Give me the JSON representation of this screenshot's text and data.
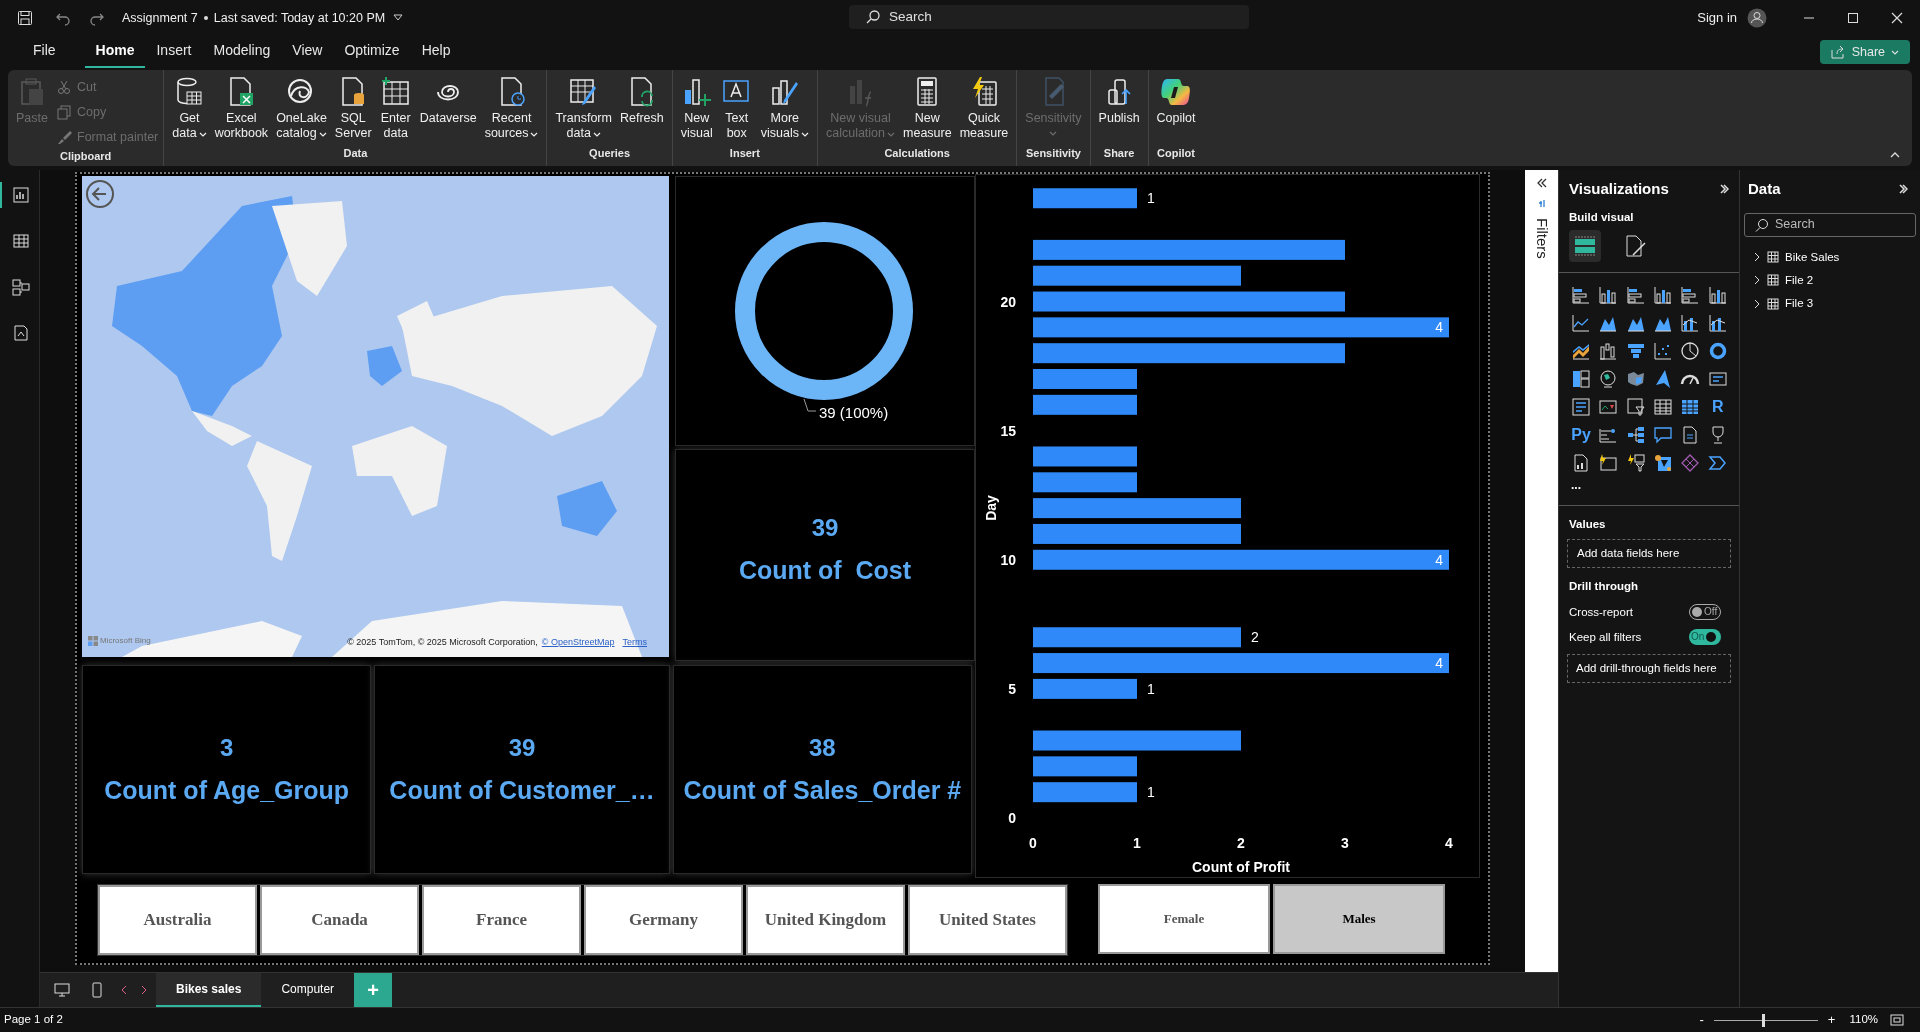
{
  "title_bar": {
    "document": "Assignment 7",
    "saved": "Last saved: Today at 10:20 PM",
    "search_placeholder": "Search",
    "sign_in": "Sign in"
  },
  "menu_tabs": [
    {
      "label": "File",
      "selected": false
    },
    {
      "label": "Home",
      "selected": true
    },
    {
      "label": "Insert",
      "selected": false
    },
    {
      "label": "Modeling",
      "selected": false
    },
    {
      "label": "View",
      "selected": false
    },
    {
      "label": "Optimize",
      "selected": false
    },
    {
      "label": "Help",
      "selected": false
    }
  ],
  "share_button": "Share",
  "ribbon": [
    {
      "label": "Clipboard",
      "items": [
        {
          "kind": "large",
          "lines": [
            "Paste"
          ],
          "caret": false,
          "disabled": true
        },
        {
          "kind": "small",
          "lines": [
            "Cut"
          ],
          "caret": false,
          "disabled": true
        },
        {
          "kind": "small",
          "lines": [
            "Copy"
          ],
          "caret": false,
          "disabled": true
        },
        {
          "kind": "small",
          "lines": [
            "Format painter"
          ],
          "caret": false,
          "disabled": true
        }
      ]
    },
    {
      "label": "Data",
      "items": [
        {
          "kind": "large",
          "lines": [
            "Get",
            "data"
          ],
          "caret": true,
          "disabled": false
        },
        {
          "kind": "large",
          "lines": [
            "Excel",
            "workbook"
          ],
          "caret": false,
          "disabled": false
        },
        {
          "kind": "large",
          "lines": [
            "OneLake",
            "catalog"
          ],
          "caret": true,
          "disabled": false
        },
        {
          "kind": "large",
          "lines": [
            "SQL",
            "Server"
          ],
          "caret": false,
          "disabled": false
        },
        {
          "kind": "large",
          "lines": [
            "Enter",
            "data"
          ],
          "caret": false,
          "disabled": false
        },
        {
          "kind": "large",
          "lines": [
            "Dataverse"
          ],
          "caret": false,
          "disabled": false
        },
        {
          "kind": "large",
          "lines": [
            "Recent",
            "sources"
          ],
          "caret": true,
          "disabled": false
        }
      ]
    },
    {
      "label": "Queries",
      "items": [
        {
          "kind": "large",
          "lines": [
            "Transform",
            "data"
          ],
          "caret": true,
          "disabled": false
        },
        {
          "kind": "large",
          "lines": [
            "Refresh"
          ],
          "caret": false,
          "disabled": false
        }
      ]
    },
    {
      "label": "Insert",
      "items": [
        {
          "kind": "large",
          "lines": [
            "New",
            "visual"
          ],
          "caret": false,
          "disabled": false
        },
        {
          "kind": "large",
          "lines": [
            "Text",
            "box"
          ],
          "caret": false,
          "disabled": false
        },
        {
          "kind": "large",
          "lines": [
            "More",
            "visuals"
          ],
          "caret": true,
          "disabled": false
        }
      ]
    },
    {
      "label": "Calculations",
      "items": [
        {
          "kind": "large",
          "lines": [
            "New visual",
            "calculation"
          ],
          "caret": true,
          "disabled": true
        },
        {
          "kind": "large",
          "lines": [
            "New",
            "measure"
          ],
          "caret": false,
          "disabled": false
        },
        {
          "kind": "large",
          "lines": [
            "Quick",
            "measure"
          ],
          "caret": false,
          "disabled": false
        }
      ]
    },
    {
      "label": "Sensitivity",
      "items": [
        {
          "kind": "large",
          "lines": [
            "Sensitivity"
          ],
          "caret": true,
          "disabled": true
        }
      ]
    },
    {
      "label": "Share",
      "items": [
        {
          "kind": "large",
          "lines": [
            "Publish"
          ],
          "caret": false,
          "disabled": false
        }
      ]
    },
    {
      "label": "Copilot",
      "items": [
        {
          "kind": "large",
          "lines": [
            "Copilot"
          ],
          "caret": false,
          "disabled": false
        }
      ]
    }
  ],
  "view_switcher": [
    {
      "selected": true
    },
    {
      "selected": false
    },
    {
      "selected": false
    },
    {
      "selected": false
    }
  ],
  "map": {
    "kind": "picture",
    "provider": "Microsoft Bing",
    "attribution": "© 2025 TomTom, © 2025 Microsoft Corporation,",
    "attribution_link": "© OpenStreetMap",
    "terms": "Terms"
  },
  "donut": {
    "data_label": "39 (100%)"
  },
  "cards": [
    {
      "value": "39",
      "label": "Count of  Cost"
    },
    {
      "value": "3",
      "label": "Count of Age_Group"
    },
    {
      "value": "39",
      "label": "Count of Customer_…"
    },
    {
      "value": "38",
      "label": "Count of Sales_Order #"
    }
  ],
  "bar_chart": {
    "chart_data": {
      "type": "bar",
      "orientation": "horizontal",
      "xlabel": "Count of Profit",
      "ylabel": "Day",
      "x": [
        24,
        22,
        21,
        20,
        19,
        18,
        17,
        16,
        14,
        13,
        12,
        11,
        10,
        7,
        6,
        5,
        3,
        2,
        1
      ],
      "values": [
        1,
        3,
        2,
        3,
        4,
        3,
        1,
        1,
        1,
        1,
        2,
        2,
        4,
        2,
        4,
        1,
        2,
        1,
        1
      ],
      "value_labels": [
        "1",
        null,
        null,
        null,
        "4",
        null,
        null,
        null,
        null,
        null,
        null,
        null,
        "4",
        "2",
        "4",
        "1",
        null,
        null,
        "1"
      ],
      "xlim": [
        0,
        4
      ],
      "ylim": [
        0,
        24.9
      ],
      "xticks": [
        0,
        1,
        2,
        3,
        4
      ],
      "yticks": [
        0,
        5,
        10,
        15,
        20
      ]
    }
  },
  "country_slicer": [
    {
      "label": "Australia",
      "selected": false
    },
    {
      "label": "Canada",
      "selected": false
    },
    {
      "label": "France",
      "selected": false
    },
    {
      "label": "Germany",
      "selected": false
    },
    {
      "label": "United Kingdom",
      "selected": false
    },
    {
      "label": "United States",
      "selected": false
    }
  ],
  "gender_slicer": [
    {
      "label": "Female",
      "selected": false
    },
    {
      "label": "Males",
      "selected": true
    }
  ],
  "filters_label": "Filters",
  "visualizations": {
    "title": "Visualizations",
    "build_visual": "Build visual",
    "script_visuals": [
      "R",
      "Py"
    ],
    "more": "...",
    "values_label": "Values",
    "values_drop": "Add data fields here",
    "drill_through": "Drill through",
    "toggles": [
      {
        "label": "Cross-report",
        "state_text": "Off",
        "on": false
      },
      {
        "label": "Keep all filters",
        "state_text": "On",
        "on": true
      }
    ],
    "drill_drop": "Add drill-through fields here"
  },
  "data_pane": {
    "title": "Data",
    "search_placeholder": "Search",
    "tables": [
      {
        "label": "Bike Sales",
        "expanded": false
      },
      {
        "label": "File 2",
        "expanded": false
      },
      {
        "label": "File 3",
        "expanded": false
      }
    ]
  },
  "page_tabs": [
    {
      "label": "Bikes sales",
      "selected": true
    },
    {
      "label": "Computer",
      "selected": false
    }
  ],
  "add_page": "+",
  "status_bar": {
    "page": "Page 1 of 2",
    "zoom_out": "-",
    "zoom_in": "+",
    "zoom": "110%",
    "zoom_slider": {
      "level": 0.48
    }
  }
}
